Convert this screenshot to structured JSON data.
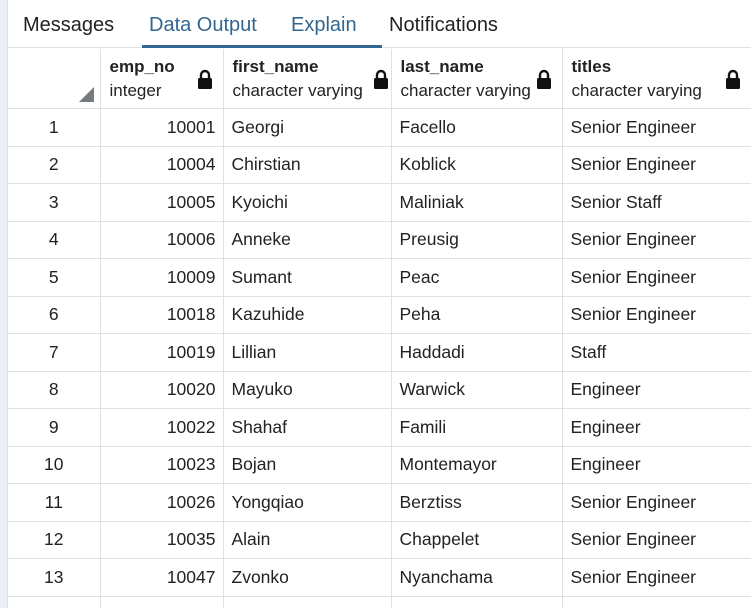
{
  "tabs": [
    {
      "label": "Messages"
    },
    {
      "label": "Data Output"
    },
    {
      "label": "Explain"
    },
    {
      "label": "Notifications"
    }
  ],
  "columns": [
    {
      "name": "emp_no",
      "type": "integer"
    },
    {
      "name": "first_name",
      "type": "character varying"
    },
    {
      "name": "last_name",
      "type": "character varying"
    },
    {
      "name": "titles",
      "type": "character varying"
    }
  ],
  "rows": [
    {
      "index": "1",
      "emp_no": "10001",
      "first_name": "Georgi",
      "last_name": "Facello",
      "titles": "Senior Engineer"
    },
    {
      "index": "2",
      "emp_no": "10004",
      "first_name": "Chirstian",
      "last_name": "Koblick",
      "titles": "Senior Engineer"
    },
    {
      "index": "3",
      "emp_no": "10005",
      "first_name": "Kyoichi",
      "last_name": "Maliniak",
      "titles": "Senior Staff"
    },
    {
      "index": "4",
      "emp_no": "10006",
      "first_name": "Anneke",
      "last_name": "Preusig",
      "titles": "Senior Engineer"
    },
    {
      "index": "5",
      "emp_no": "10009",
      "first_name": "Sumant",
      "last_name": "Peac",
      "titles": "Senior Engineer"
    },
    {
      "index": "6",
      "emp_no": "10018",
      "first_name": "Kazuhide",
      "last_name": "Peha",
      "titles": "Senior Engineer"
    },
    {
      "index": "7",
      "emp_no": "10019",
      "first_name": "Lillian",
      "last_name": "Haddadi",
      "titles": "Staff"
    },
    {
      "index": "8",
      "emp_no": "10020",
      "first_name": "Mayuko",
      "last_name": "Warwick",
      "titles": "Engineer"
    },
    {
      "index": "9",
      "emp_no": "10022",
      "first_name": "Shahaf",
      "last_name": "Famili",
      "titles": "Engineer"
    },
    {
      "index": "10",
      "emp_no": "10023",
      "first_name": "Bojan",
      "last_name": "Montemayor",
      "titles": "Engineer"
    },
    {
      "index": "11",
      "emp_no": "10026",
      "first_name": "Yongqiao",
      "last_name": "Berztiss",
      "titles": "Senior Engineer"
    },
    {
      "index": "12",
      "emp_no": "10035",
      "first_name": "Alain",
      "last_name": "Chappelet",
      "titles": "Senior Engineer"
    },
    {
      "index": "13",
      "emp_no": "10047",
      "first_name": "Zvonko",
      "last_name": "Nyanchama",
      "titles": "Senior Engineer"
    },
    {
      "index": "",
      "emp_no": "",
      "first_name": "",
      "last_name": "",
      "titles": ""
    }
  ],
  "icons": {
    "lock": "lock-icon",
    "select_all": "select-all-corner-icon"
  },
  "colors": {
    "accent": "#326690",
    "grid_line": "#dde0e6",
    "text": "#222222"
  }
}
